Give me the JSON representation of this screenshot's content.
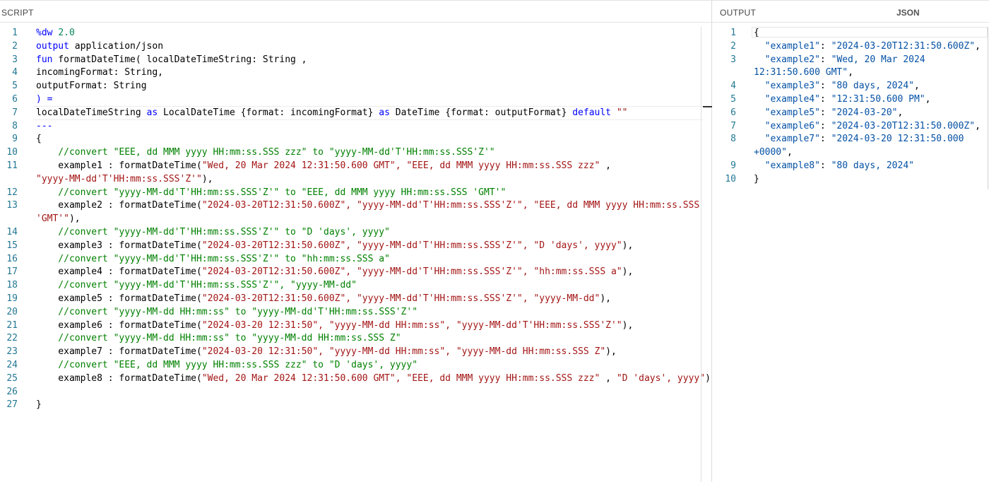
{
  "script": {
    "title": "SCRIPT",
    "lines": [
      {
        "num": "1",
        "parts": [
          [
            "k",
            "%dw "
          ],
          [
            "n",
            "2.0"
          ]
        ]
      },
      {
        "num": "2",
        "parts": [
          [
            "k",
            "output"
          ],
          [
            "t",
            " application/json"
          ]
        ]
      },
      {
        "num": "3",
        "parts": [
          [
            "k",
            "fun"
          ],
          [
            "t",
            " formatDateTime( localDateTimeString: String ,"
          ]
        ]
      },
      {
        "num": "4",
        "parts": [
          [
            "t",
            "incomingFormat: String,"
          ]
        ]
      },
      {
        "num": "5",
        "parts": [
          [
            "t",
            "outputFormat: String"
          ]
        ]
      },
      {
        "num": "6",
        "parts": [
          [
            "k",
            ") ="
          ]
        ]
      },
      {
        "num": "7",
        "parts": [
          [
            "t",
            "localDateTimeString "
          ],
          [
            "k",
            "as"
          ],
          [
            "t",
            " LocalDateTime {format: incomingFormat} "
          ],
          [
            "k",
            "as"
          ],
          [
            "t",
            " DateTime {format: outputFormat} "
          ],
          [
            "k",
            "default"
          ],
          [
            "s",
            " \"\""
          ]
        ]
      },
      {
        "num": "8",
        "parts": [
          [
            "k",
            "---"
          ]
        ]
      },
      {
        "num": "9",
        "parts": [
          [
            "t",
            "{"
          ]
        ]
      },
      {
        "num": "10",
        "parts": [
          [
            "c",
            "    //convert \"EEE, dd MMM yyyy HH:mm:ss.SSS zzz\" to \"yyyy-MM-dd'T'HH:mm:ss.SSS'Z'\""
          ]
        ]
      },
      {
        "num": "11",
        "parts": [
          [
            "t",
            "    example1 : formatDateTime("
          ],
          [
            "s",
            "\"Wed, 20 Mar 2024 12:31:50.600 GMT\", \"EEE, dd MMM yyyy HH:mm:ss.SSS zzz\""
          ],
          [
            "t",
            " ,"
          ]
        ]
      },
      {
        "num": "",
        "parts": [
          [
            "s",
            "\"yyyy-MM-dd'T'HH:mm:ss.SSS'Z'\""
          ],
          [
            "t",
            "),"
          ]
        ]
      },
      {
        "num": "12",
        "parts": [
          [
            "c",
            "    //convert \"yyyy-MM-dd'T'HH:mm:ss.SSS'Z'\" to \"EEE, dd MMM yyyy HH:mm:ss.SSS 'GMT'\""
          ]
        ]
      },
      {
        "num": "13",
        "parts": [
          [
            "t",
            "    example2 : formatDateTime("
          ],
          [
            "s",
            "\"2024-03-20T12:31:50.600Z\", \"yyyy-MM-dd'T'HH:mm:ss.SSS'Z'\", \"EEE, dd MMM yyyy HH:mm:ss.SSS"
          ]
        ]
      },
      {
        "num": "",
        "parts": [
          [
            "s",
            "'GMT'\""
          ],
          [
            "t",
            "),"
          ]
        ]
      },
      {
        "num": "14",
        "parts": [
          [
            "c",
            "    //convert \"yyyy-MM-dd'T'HH:mm:ss.SSS'Z'\" to \"D 'days', yyyy\""
          ]
        ]
      },
      {
        "num": "15",
        "parts": [
          [
            "t",
            "    example3 : formatDateTime("
          ],
          [
            "s",
            "\"2024-03-20T12:31:50.600Z\", \"yyyy-MM-dd'T'HH:mm:ss.SSS'Z'\", \"D 'days', yyyy\""
          ],
          [
            "t",
            "),"
          ]
        ]
      },
      {
        "num": "16",
        "parts": [
          [
            "c",
            "    //convert \"yyyy-MM-dd'T'HH:mm:ss.SSS'Z'\" to \"hh:mm:ss.SSS a\""
          ]
        ]
      },
      {
        "num": "17",
        "parts": [
          [
            "t",
            "    example4 : formatDateTime("
          ],
          [
            "s",
            "\"2024-03-20T12:31:50.600Z\", \"yyyy-MM-dd'T'HH:mm:ss.SSS'Z'\", \"hh:mm:ss.SSS a\""
          ],
          [
            "t",
            "),"
          ]
        ]
      },
      {
        "num": "18",
        "parts": [
          [
            "c",
            "    //convert \"yyyy-MM-dd'T'HH:mm:ss.SSS'Z'\", \"yyyy-MM-dd\""
          ]
        ]
      },
      {
        "num": "19",
        "parts": [
          [
            "t",
            "    example5 : formatDateTime("
          ],
          [
            "s",
            "\"2024-03-20T12:31:50.600Z\", \"yyyy-MM-dd'T'HH:mm:ss.SSS'Z'\", \"yyyy-MM-dd\""
          ],
          [
            "t",
            "),"
          ]
        ]
      },
      {
        "num": "20",
        "parts": [
          [
            "c",
            "    //convert \"yyyy-MM-dd HH:mm:ss\" to \"yyyy-MM-dd'T'HH:mm:ss.SSS'Z'\""
          ]
        ]
      },
      {
        "num": "21",
        "parts": [
          [
            "t",
            "    example6 : formatDateTime("
          ],
          [
            "s",
            "\"2024-03-20 12:31:50\", \"yyyy-MM-dd HH:mm:ss\", \"yyyy-MM-dd'T'HH:mm:ss.SSS'Z'\""
          ],
          [
            "t",
            "),"
          ]
        ]
      },
      {
        "num": "22",
        "parts": [
          [
            "c",
            "    //convert \"yyyy-MM-dd HH:mm:ss\" to \"yyyy-MM-dd HH:mm:ss.SSS Z\""
          ]
        ]
      },
      {
        "num": "23",
        "parts": [
          [
            "t",
            "    example7 : formatDateTime("
          ],
          [
            "s",
            "\"2024-03-20 12:31:50\", \"yyyy-MM-dd HH:mm:ss\", \"yyyy-MM-dd HH:mm:ss.SSS Z\""
          ],
          [
            "t",
            "),"
          ]
        ]
      },
      {
        "num": "24",
        "parts": [
          [
            "c",
            "    //convert \"EEE, dd MMM yyyy HH:mm:ss.SSS zzz\" to \"D 'days', yyyy\""
          ]
        ]
      },
      {
        "num": "25",
        "parts": [
          [
            "t",
            "    example8 : formatDateTime("
          ],
          [
            "s",
            "\"Wed, 20 Mar 2024 12:31:50.600 GMT\", \"EEE, dd MMM yyyy HH:mm:ss.SSS zzz\""
          ],
          [
            "t",
            " , "
          ],
          [
            "s",
            "\"D 'days', yyyy\""
          ],
          [
            "t",
            ")"
          ]
        ]
      },
      {
        "num": "26",
        "parts": [
          [
            "t",
            ""
          ]
        ]
      },
      {
        "num": "27",
        "parts": [
          [
            "t",
            "}"
          ]
        ]
      }
    ]
  },
  "output": {
    "title": "OUTPUT",
    "format": "JSON",
    "lines": [
      {
        "num": "1",
        "parts": [
          [
            "t",
            "{"
          ]
        ]
      },
      {
        "num": "2",
        "parts": [
          [
            "jk",
            "  \"example1\""
          ],
          [
            "t",
            ": "
          ],
          [
            "js",
            "\"2024-03-20T12:31:50.600Z\""
          ],
          [
            "t",
            ","
          ]
        ]
      },
      {
        "num": "3",
        "parts": [
          [
            "jk",
            "  \"example2\""
          ],
          [
            "t",
            ": "
          ],
          [
            "js",
            "\"Wed, 20 Mar 2024"
          ]
        ]
      },
      {
        "num": "",
        "parts": [
          [
            "js",
            "12:31:50.600 GMT\""
          ],
          [
            "t",
            ","
          ]
        ]
      },
      {
        "num": "4",
        "parts": [
          [
            "jk",
            "  \"example3\""
          ],
          [
            "t",
            ": "
          ],
          [
            "js",
            "\"80 days, 2024\""
          ],
          [
            "t",
            ","
          ]
        ]
      },
      {
        "num": "5",
        "parts": [
          [
            "jk",
            "  \"example4\""
          ],
          [
            "t",
            ": "
          ],
          [
            "js",
            "\"12:31:50.600 PM\""
          ],
          [
            "t",
            ","
          ]
        ]
      },
      {
        "num": "6",
        "parts": [
          [
            "jk",
            "  \"example5\""
          ],
          [
            "t",
            ": "
          ],
          [
            "js",
            "\"2024-03-20\""
          ],
          [
            "t",
            ","
          ]
        ]
      },
      {
        "num": "7",
        "parts": [
          [
            "jk",
            "  \"example6\""
          ],
          [
            "t",
            ": "
          ],
          [
            "js",
            "\"2024-03-20T12:31:50.000Z\""
          ],
          [
            "t",
            ","
          ]
        ]
      },
      {
        "num": "8",
        "parts": [
          [
            "jk",
            "  \"example7\""
          ],
          [
            "t",
            ": "
          ],
          [
            "js",
            "\"2024-03-20 12:31:50.000"
          ]
        ]
      },
      {
        "num": "",
        "parts": [
          [
            "js",
            "+0000\""
          ],
          [
            "t",
            ","
          ]
        ]
      },
      {
        "num": "9",
        "parts": [
          [
            "jk",
            "  \"example8\""
          ],
          [
            "t",
            ": "
          ],
          [
            "js",
            "\"80 days, 2024\""
          ]
        ]
      },
      {
        "num": "10",
        "parts": [
          [
            "t",
            "}"
          ]
        ]
      }
    ]
  }
}
